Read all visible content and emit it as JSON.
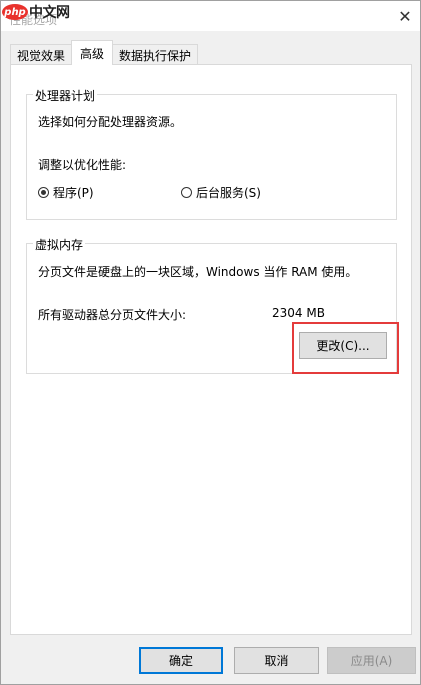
{
  "window": {
    "title": "性能选项",
    "watermark": {
      "logo": "php",
      "text": "中文网"
    }
  },
  "tabs": [
    {
      "label": "视觉效果"
    },
    {
      "label": "高级"
    },
    {
      "label": "数据执行保护"
    }
  ],
  "processor_scheduling": {
    "title": "处理器计划",
    "description": "选择如何分配处理器资源。",
    "adjust_label": "调整以优化性能:",
    "options": [
      {
        "label": "程序(P)",
        "selected": true
      },
      {
        "label": "后台服务(S)",
        "selected": false
      }
    ]
  },
  "virtual_memory": {
    "title": "虚拟内存",
    "description": "分页文件是硬盘上的一块区域，Windows 当作 RAM 使用。",
    "total_label": "所有驱动器总分页文件大小:",
    "total_value": "2304 MB",
    "change_button": "更改(C)..."
  },
  "footer": {
    "ok": "确定",
    "cancel": "取消",
    "apply": "应用(A)"
  },
  "colors": {
    "highlight": "#e43b3b",
    "accent": "#0078d7"
  }
}
